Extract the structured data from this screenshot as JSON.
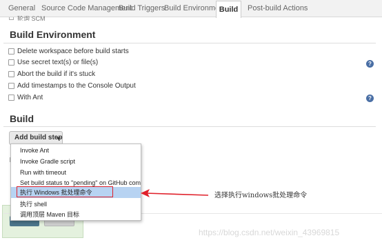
{
  "tabs": [
    {
      "label": "General",
      "active": false
    },
    {
      "label": "Source Code Management",
      "active": false
    },
    {
      "label": "Build Triggers",
      "active": false
    },
    {
      "label": "Build Environment",
      "active": false
    },
    {
      "label": "Build",
      "active": true
    },
    {
      "label": "Post-build Actions",
      "active": false
    }
  ],
  "prev_section": {
    "partial_label": "轮询 SCM"
  },
  "build_environment": {
    "title": "Build Environment",
    "options": [
      {
        "label": "Delete workspace before build starts",
        "checked": false,
        "help": false
      },
      {
        "label": "Use secret text(s) or file(s)",
        "checked": false,
        "help": true
      },
      {
        "label": "Abort the build if it's stuck",
        "checked": false,
        "help": false
      },
      {
        "label": "Add timestamps to the Console Output",
        "checked": false,
        "help": false
      },
      {
        "label": "With Ant",
        "checked": false,
        "help": true
      }
    ]
  },
  "build": {
    "title": "Build",
    "add_step_label": "Add build step"
  },
  "menu": {
    "items": [
      {
        "label": "Invoke Ant",
        "highlighted": false
      },
      {
        "label": "Invoke Gradle script",
        "highlighted": false
      },
      {
        "label": "Run with timeout",
        "highlighted": false
      },
      {
        "label": "Set build status to \"pending\" on GitHub commit",
        "highlighted": false
      },
      {
        "label": "执行 Windows 批处理命令",
        "highlighted": true
      },
      {
        "label": "执行 shell",
        "highlighted": false
      },
      {
        "label": "调用顶层 Maven 目标",
        "highlighted": false
      }
    ]
  },
  "annotation": {
    "text": "选择执行windows批处理命令",
    "color": "#e0202a"
  },
  "watermark": {
    "text": "https://blog.csdn.net/weixin_43969815"
  },
  "icons": {
    "help": "question-mark-icon",
    "dropdown": "caret-down-icon",
    "annotation": "red-arrow-icon"
  },
  "colors": {
    "highlight": "#b7d3f2",
    "save_button": "#4b758b",
    "help": "#4a6fa5",
    "annotation_red": "#e0202a"
  }
}
